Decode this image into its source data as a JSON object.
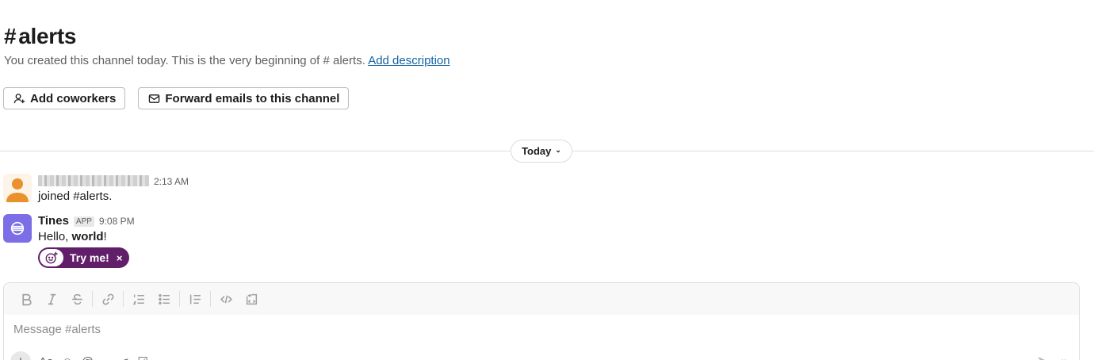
{
  "channel": {
    "name": "alerts",
    "hash": "#",
    "desc_prefix": "You created this channel today. This is the very beginning of",
    "desc_channel": "# alerts.",
    "add_description": "Add description"
  },
  "actions": {
    "add_coworkers": "Add coworkers",
    "forward_emails": "Forward emails to this channel"
  },
  "divider": {
    "label": "Today",
    "chevron": "⌄"
  },
  "messages": [
    {
      "time": "2:13 AM",
      "text": "joined #alerts."
    },
    {
      "author": "Tines",
      "badge": "APP",
      "time": "9:08 PM",
      "text_before": "Hello, ",
      "text_bold": "world",
      "text_after": "!"
    }
  ],
  "try_button": {
    "label": "Try me!",
    "close": "×"
  },
  "composer": {
    "placeholder": "Message #alerts",
    "toolbar_icons": [
      "bold-icon",
      "italic-icon",
      "strikethrough-icon",
      "link-icon",
      "ordered-list-icon",
      "bulleted-list-icon",
      "blockquote-icon",
      "code-icon",
      "code-block-icon"
    ],
    "bottom": {
      "plus": "+",
      "format": "Aa"
    }
  },
  "colors": {
    "accent": "#611f69",
    "link": "#1264a3",
    "app_avatar": "#7c6ee6",
    "user_avatar": "#e8912d"
  }
}
